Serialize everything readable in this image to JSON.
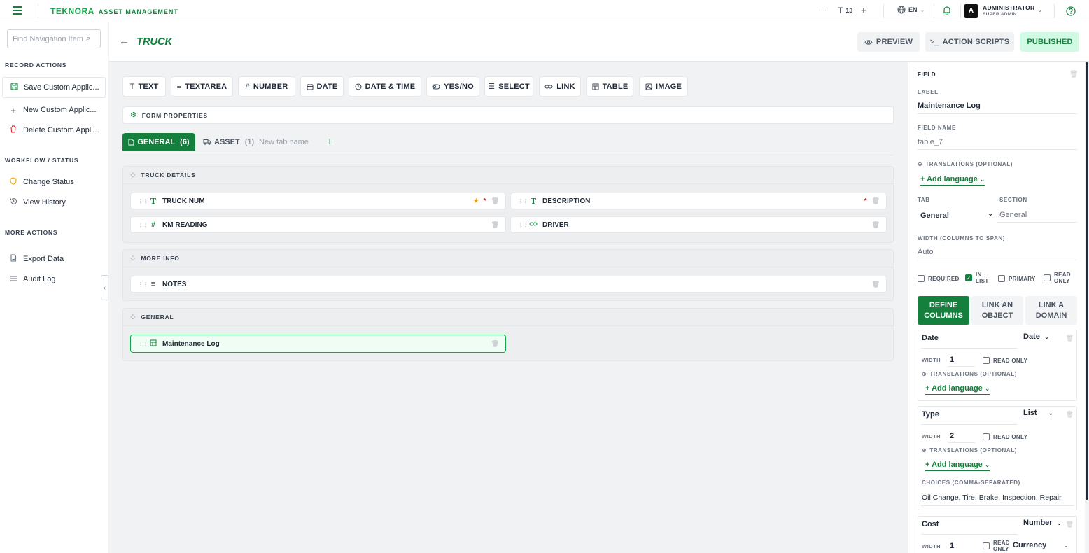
{
  "topbar": {
    "brand_name": "TEKNORA",
    "brand_sub": "ASSET MANAGEMENT",
    "font_size_label": "13",
    "language": "EN",
    "user_name": "ADMINISTRATOR",
    "user_role": "SUPER ADMIN",
    "avatar_letter": "A"
  },
  "sidebar": {
    "search_placeholder": "Find Navigation Item",
    "record_actions_heading": "RECORD ACTIONS",
    "record_actions": [
      {
        "label": "Save Custom Applic...",
        "icon": "save-icon"
      },
      {
        "label": "New Custom Applic...",
        "icon": "plus-icon"
      },
      {
        "label": "Delete Custom Appli...",
        "icon": "trash-icon"
      }
    ],
    "workflow_heading": "WORKFLOW / STATUS",
    "workflow": [
      {
        "label": "Change Status",
        "icon": "shield-icon"
      },
      {
        "label": "View History",
        "icon": "history-icon"
      }
    ],
    "more_heading": "MORE ACTIONS",
    "more": [
      {
        "label": "Export Data",
        "icon": "document-icon"
      },
      {
        "label": "Audit Log",
        "icon": "list-icon"
      }
    ]
  },
  "header": {
    "title": "TRUCK",
    "preview": "PREVIEW",
    "action_scripts": "ACTION SCRIPTS",
    "published": "PUBLISHED"
  },
  "field_types": [
    "TEXT",
    "TEXTAREA",
    "NUMBER",
    "DATE",
    "DATE & TIME",
    "YES/NO",
    "SELECT",
    "LINK",
    "TABLE",
    "IMAGE"
  ],
  "form_properties": "FORM PROPERTIES",
  "tabs": {
    "general_label": "GENERAL",
    "general_count": "(6)",
    "asset_label": "ASSET",
    "asset_count": "(1)",
    "new_tab_placeholder": "New tab name"
  },
  "sections": [
    {
      "title": "TRUCK DETAILS",
      "fields": [
        {
          "label": "TRUCK NUM",
          "type_icon": "T",
          "primary": true,
          "required": true
        },
        {
          "label": "DESCRIPTION",
          "type_icon": "T",
          "primary": false,
          "required": true
        },
        {
          "label": "KM READING",
          "type_icon": "#",
          "primary": false,
          "required": false
        },
        {
          "label": "DRIVER",
          "type_icon": "link",
          "primary": false,
          "required": false
        }
      ]
    },
    {
      "title": "MORE INFO",
      "fields": [
        {
          "label": "NOTES",
          "type_icon": "textarea",
          "primary": false,
          "required": false
        }
      ]
    },
    {
      "title": "GENERAL",
      "fields": [
        {
          "label": "Maintenance Log",
          "type_icon": "table",
          "primary": false,
          "required": false,
          "selected": true
        }
      ]
    }
  ],
  "field_panel": {
    "heading": "FIELD",
    "label_lbl": "LABEL",
    "label_val": "Maintenance Log",
    "field_name_lbl": "FIELD NAME",
    "field_name_val": "table_7",
    "translations_lbl": "TRANSLATIONS (OPTIONAL)",
    "add_language": "+ Add language",
    "tab_lbl": "TAB",
    "tab_val": "General",
    "section_lbl": "SECTION",
    "section_val": "General",
    "width_lbl": "WIDTH (COLUMNS TO SPAN)",
    "width_val": "Auto",
    "required": "REQUIRED",
    "in_list_1": "IN",
    "in_list_2": "LIST",
    "primary": "PRIMARY",
    "read_only_1": "READ",
    "read_only_2": "ONLY",
    "seg_define_1": "DEFINE",
    "seg_define_2": "COLUMNS",
    "seg_object_1": "LINK AN",
    "seg_object_2": "OBJECT",
    "seg_domain_1": "LINK A",
    "seg_domain_2": "DOMAIN",
    "columns": [
      {
        "name": "Date",
        "type": "Date",
        "width": "1",
        "read_only": "READ ONLY",
        "translations": "TRANSLATIONS (OPTIONAL)",
        "add_language": "+ Add language"
      },
      {
        "name": "Type",
        "type": "List",
        "width": "2",
        "read_only": "READ ONLY",
        "translations": "TRANSLATIONS (OPTIONAL)",
        "add_language": "+ Add language",
        "choices_lbl": "CHOICES (COMMA-SEPARATED)",
        "choices": "Oil Change, Tire, Brake, Inspection, Repair"
      },
      {
        "name": "Cost",
        "type": "Number",
        "width": "1",
        "read_only_1": "READ",
        "read_only_2": "ONLY",
        "format": "Currency"
      }
    ],
    "width_short": "WIDTH"
  }
}
